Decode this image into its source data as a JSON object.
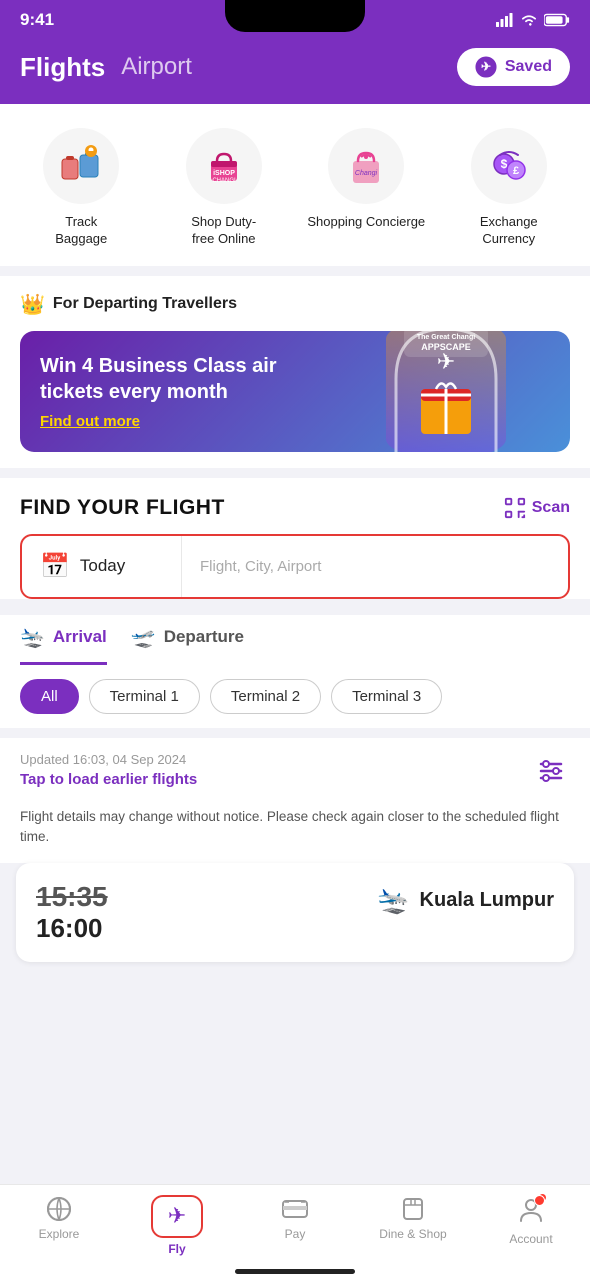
{
  "statusBar": {
    "time": "9:41",
    "signalBars": "signal-icon",
    "wifi": "wifi-icon",
    "battery": "battery-icon"
  },
  "header": {
    "activeTab": "Flights",
    "inactiveTab": "Airport",
    "savedButton": "Saved"
  },
  "quickActions": [
    {
      "label": "Track\nBaggage",
      "icon": "baggage-icon"
    },
    {
      "label": "Shop Duty-\nfree Online",
      "icon": "shop-icon"
    },
    {
      "label": "Shopping\nConcierge",
      "icon": "concierge-icon"
    },
    {
      "label": "Exchange\nCurrency",
      "icon": "currency-icon"
    }
  ],
  "promo": {
    "forLabel": "For Departing Travellers",
    "crownIcon": "crown-icon",
    "bannerHeading": "Win 4 Business Class air tickets every month",
    "bannerLink": "Find out more",
    "badgeText": "The Great Changi\nAPPSCAPADE"
  },
  "findFlight": {
    "title": "FIND YOUR FLIGHT",
    "scanLabel": "Scan",
    "scanIcon": "scan-icon",
    "datePlaceholder": "Today",
    "calendarIcon": "calendar-icon",
    "searchPlaceholder": "Flight, City, Airport"
  },
  "flightTabs": [
    {
      "label": "Arrival",
      "icon": "arrival-plane-icon",
      "active": true
    },
    {
      "label": "Departure",
      "icon": "departure-plane-icon",
      "active": false
    }
  ],
  "terminalFilters": [
    {
      "label": "All",
      "active": true
    },
    {
      "label": "Terminal 1",
      "active": false
    },
    {
      "label": "Terminal 2",
      "active": false
    },
    {
      "label": "Terminal 3",
      "active": false
    }
  ],
  "flightList": {
    "updatedText": "Updated 16:03, 04 Sep 2024",
    "tapEarlier": "Tap to load earlier flights",
    "filterIcon": "filter-icon",
    "noticeText": "Flight details may change without notice. Please check again closer to the scheduled flight time."
  },
  "flightCards": [
    {
      "scheduledTime": "15:35",
      "actualTime": "16:00",
      "strikeThrough": true,
      "destination": "Kuala Lumpur",
      "planeIcon": "arrival-icon"
    }
  ],
  "bottomNav": [
    {
      "label": "Explore",
      "icon": "explore-icon",
      "active": false
    },
    {
      "label": "Fly",
      "icon": "fly-icon",
      "active": true
    },
    {
      "label": "Pay",
      "icon": "pay-icon",
      "active": false
    },
    {
      "label": "Dine & Shop",
      "icon": "dine-shop-icon",
      "active": false
    },
    {
      "label": "Account",
      "icon": "account-icon",
      "active": false,
      "hasDot": true
    }
  ]
}
